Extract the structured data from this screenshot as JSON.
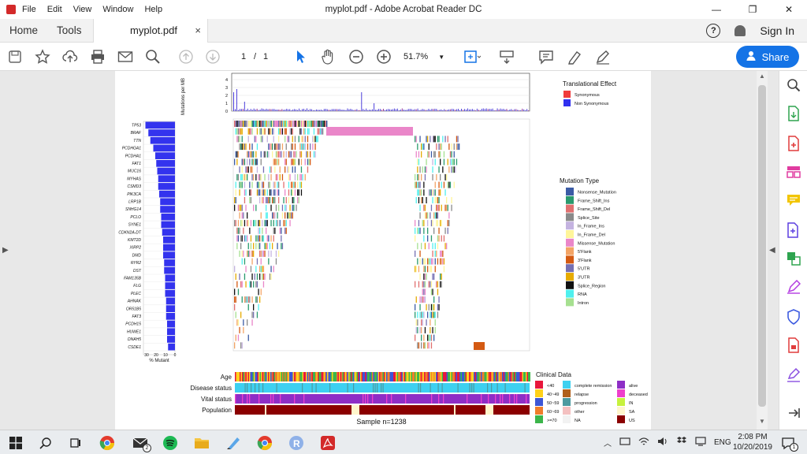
{
  "window": {
    "menu": [
      "File",
      "Edit",
      "View",
      "Window",
      "Help"
    ],
    "title": "myplot.pdf - Adobe Acrobat Reader DC",
    "controls": [
      "—",
      "❐",
      "✕"
    ]
  },
  "tabs": {
    "home": "Home",
    "tools": "Tools",
    "document": "myplot.pdf",
    "close": "×",
    "sign_in": "Sign In",
    "help": "?"
  },
  "toolbar": {
    "page_current": "1",
    "page_sep": "/",
    "page_total": "1",
    "zoom": "51.7%",
    "share_label": "Share"
  },
  "plot": {
    "tmb_ylabel": "Mutations per MB",
    "tmb_ticks": [
      "4",
      "3",
      "2",
      "1",
      "0"
    ],
    "genes": [
      "TP53",
      "BRAF",
      "TTN",
      "PCDHGA1",
      "PCDHA1",
      "FAT1",
      "MUC16",
      "MYHAS",
      "CSMD3",
      "PIK3CA",
      "LRP1B",
      "SNHG14",
      "PCLO",
      "SYNE1",
      "CDKN2A-DT",
      "KMT2D",
      "XIRP2",
      "DMD",
      "RYR2",
      "DST",
      "FAM135B",
      "FLG",
      "PLEC",
      "AHNAK",
      "OR51B5",
      "FAT3",
      "PCDH15",
      "HUWE1",
      "DNAH5",
      "CSDE1"
    ],
    "mutant_ticks": [
      "30",
      "20",
      "10",
      "0"
    ],
    "mutant_label": "% Mutant",
    "clinical_tracks": [
      "Age",
      "Disease status",
      "Vital status",
      "Population"
    ],
    "sample_label": "Sample n=1238",
    "legend_effect_title": "Translational Effect",
    "legend_effect": [
      {
        "label": "Synonymous",
        "color": "#f03c3c"
      },
      {
        "label": "Non Synonymous",
        "color": "#3030f0"
      }
    ],
    "legend_mutation_title": "Mutation Type",
    "legend_mutation": [
      {
        "label": "Nonsense_Mutation",
        "color": "#3b5ba5"
      },
      {
        "label": "Frame_Shift_Ins",
        "color": "#2a9a6e"
      },
      {
        "label": "Frame_Shift_Del",
        "color": "#e07070"
      },
      {
        "label": "Splice_Site",
        "color": "#8a8a8a"
      },
      {
        "label": "In_Frame_Ins",
        "color": "#c4b3e0"
      },
      {
        "label": "In_Frame_Del",
        "color": "#fff59a"
      },
      {
        "label": "Missense_Mutation",
        "color": "#ea86c9"
      },
      {
        "label": "5'Flank",
        "color": "#f3a465"
      },
      {
        "label": "3'Flank",
        "color": "#d45a12"
      },
      {
        "label": "5'UTR",
        "color": "#7570b3"
      },
      {
        "label": "3'UTR",
        "color": "#e6ab02"
      },
      {
        "label": "Splice_Region",
        "color": "#111111"
      },
      {
        "label": "RNA",
        "color": "#4ff0ee"
      },
      {
        "label": "Intron",
        "color": "#a6e090"
      }
    ],
    "legend_clinical_title": "Clinical Data",
    "legend_clinical_col1": [
      {
        "label": "<40",
        "color": "#e8173c"
      },
      {
        "label": "40~49",
        "color": "#ffd11a"
      },
      {
        "label": "50~59",
        "color": "#3d56d6"
      },
      {
        "label": "60~69",
        "color": "#f07d2a"
      },
      {
        "label": ">=70",
        "color": "#3bb54a"
      }
    ],
    "legend_clinical_col2": [
      {
        "label": "complete remission",
        "color": "#3ed0f0"
      },
      {
        "label": "relapse",
        "color": "#b0601c"
      },
      {
        "label": "progression",
        "color": "#4d9aa0"
      },
      {
        "label": "other",
        "color": "#f4c0c0"
      },
      {
        "label": "NA",
        "color": "#f2f2f2"
      }
    ],
    "legend_clinical_col3": [
      {
        "label": "alive",
        "color": "#8e2ec6"
      },
      {
        "label": "deceased",
        "color": "#ee40cc"
      },
      {
        "label": "IN",
        "color": "#c7f23d"
      },
      {
        "label": "SA",
        "color": "#fff6cc"
      },
      {
        "label": "US",
        "color": "#8b0000"
      }
    ]
  },
  "taskbar": {
    "language": "ENG",
    "time": "2:08 PM",
    "date": "10/20/2019",
    "mail_badge": "2",
    "notif_badge": "1"
  }
}
